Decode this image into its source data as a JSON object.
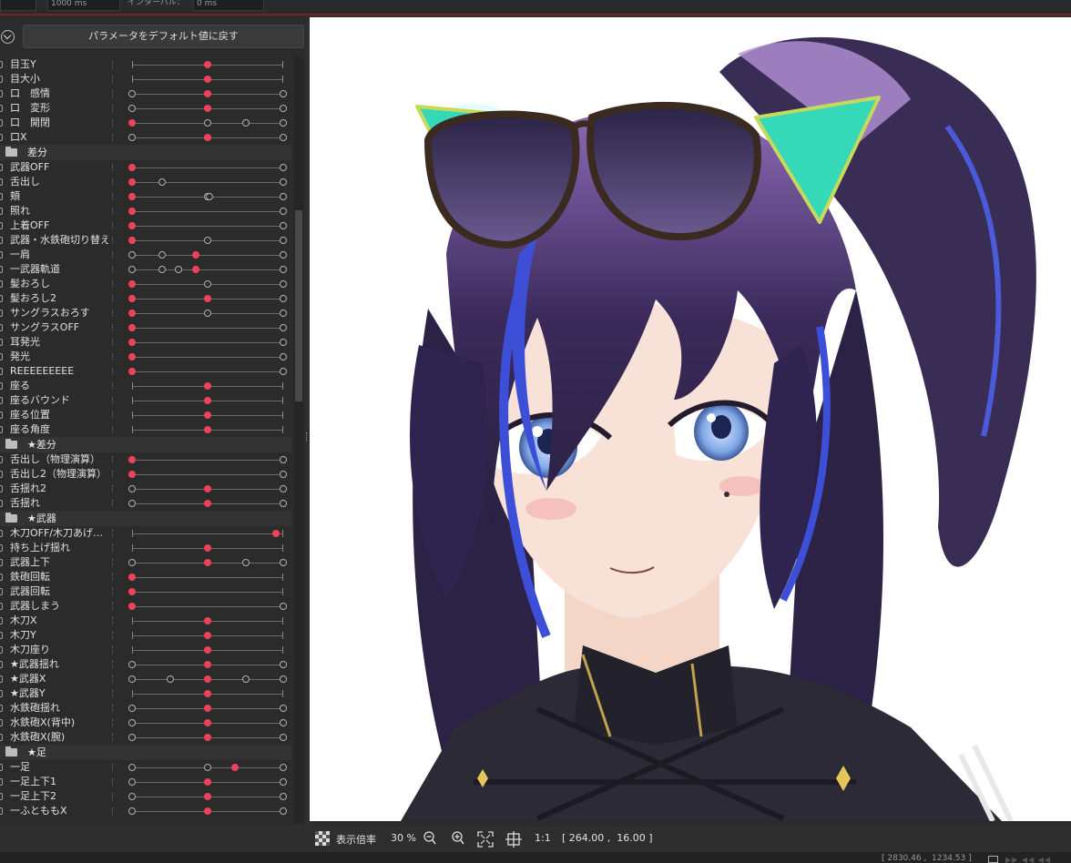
{
  "topbar": {
    "field1": "1000 ms",
    "label2": "インターバル：",
    "field2": "0 ms"
  },
  "panel": {
    "reset_button": "パラメータをデフォルト値に戻す",
    "items": [
      {
        "kind": "param",
        "label": "目玉Y",
        "dots": [
          {
            "p": 0.5,
            "s": "active"
          }
        ]
      },
      {
        "kind": "param",
        "label": "目大小",
        "dots": [
          {
            "p": 0.5,
            "s": "active"
          }
        ]
      },
      {
        "kind": "param",
        "label": "口　感情",
        "dots": [
          {
            "p": 0,
            "s": "hollow"
          },
          {
            "p": 0.5,
            "s": "active"
          },
          {
            "p": 1,
            "s": "hollow"
          }
        ]
      },
      {
        "kind": "param",
        "label": "口　変形",
        "dots": [
          {
            "p": 0,
            "s": "hollow"
          },
          {
            "p": 0.5,
            "s": "active"
          },
          {
            "p": 1,
            "s": "hollow"
          }
        ]
      },
      {
        "kind": "param",
        "label": "口　開閉",
        "dots": [
          {
            "p": 0,
            "s": "active"
          },
          {
            "p": 0.5,
            "s": "hollow"
          },
          {
            "p": 0.75,
            "s": "hollow"
          },
          {
            "p": 1,
            "s": "hollow"
          }
        ]
      },
      {
        "kind": "param",
        "label": "口X",
        "dots": [
          {
            "p": 0,
            "s": "hollow"
          },
          {
            "p": 0.5,
            "s": "active"
          },
          {
            "p": 1,
            "s": "hollow"
          }
        ]
      },
      {
        "kind": "group",
        "label": "差分"
      },
      {
        "kind": "param",
        "label": "武器OFF",
        "dots": [
          {
            "p": 0,
            "s": "active"
          },
          {
            "p": 1,
            "s": "hollow"
          }
        ]
      },
      {
        "kind": "param",
        "label": "舌出し",
        "dots": [
          {
            "p": 0,
            "s": "active"
          },
          {
            "p": 0.2,
            "s": "hollow"
          },
          {
            "p": 1,
            "s": "hollow"
          }
        ]
      },
      {
        "kind": "param",
        "label": "頬",
        "dots": [
          {
            "p": 0,
            "s": "active"
          },
          {
            "p": 0.5,
            "s": "hollow"
          },
          {
            "p": 0.51,
            "s": "hollow"
          },
          {
            "p": 1,
            "s": "hollow"
          }
        ]
      },
      {
        "kind": "param",
        "label": "照れ",
        "dots": [
          {
            "p": 0,
            "s": "active"
          },
          {
            "p": 1,
            "s": "hollow"
          }
        ]
      },
      {
        "kind": "param",
        "label": "上着OFF",
        "dots": [
          {
            "p": 0,
            "s": "active"
          },
          {
            "p": 1,
            "s": "hollow"
          }
        ]
      },
      {
        "kind": "param",
        "label": "武器・水鉄砲切り替え",
        "dots": [
          {
            "p": 0,
            "s": "active"
          },
          {
            "p": 0.5,
            "s": "hollow"
          },
          {
            "p": 1,
            "s": "hollow"
          }
        ]
      },
      {
        "kind": "param",
        "label": "一肩",
        "dots": [
          {
            "p": 0,
            "s": "hollow"
          },
          {
            "p": 0.2,
            "s": "hollow"
          },
          {
            "p": 0.42,
            "s": "active"
          },
          {
            "p": 1,
            "s": "hollow"
          }
        ]
      },
      {
        "kind": "param",
        "label": "一武器軌道",
        "dots": [
          {
            "p": 0,
            "s": "hollow"
          },
          {
            "p": 0.2,
            "s": "hollow"
          },
          {
            "p": 0.31,
            "s": "hollow"
          },
          {
            "p": 0.42,
            "s": "active"
          },
          {
            "p": 1,
            "s": "hollow"
          }
        ]
      },
      {
        "kind": "param",
        "label": "髪おろし",
        "dots": [
          {
            "p": 0,
            "s": "active"
          },
          {
            "p": 0.5,
            "s": "hollow"
          },
          {
            "p": 1,
            "s": "hollow"
          }
        ]
      },
      {
        "kind": "param",
        "label": "髪おろし2",
        "dots": [
          {
            "p": 0,
            "s": "active"
          },
          {
            "p": 0.5,
            "s": "active"
          },
          {
            "p": 1,
            "s": "hollow"
          }
        ]
      },
      {
        "kind": "param",
        "label": "サングラスおろす",
        "dots": [
          {
            "p": 0,
            "s": "active"
          },
          {
            "p": 0.5,
            "s": "hollow"
          },
          {
            "p": 1,
            "s": "hollow"
          }
        ]
      },
      {
        "kind": "param",
        "label": "サングラスOFF",
        "dots": [
          {
            "p": 0,
            "s": "active"
          },
          {
            "p": 1,
            "s": "hollow"
          }
        ]
      },
      {
        "kind": "param",
        "label": "耳発光",
        "dots": [
          {
            "p": 0,
            "s": "active"
          },
          {
            "p": 1,
            "s": "hollow"
          }
        ]
      },
      {
        "kind": "param",
        "label": "発光",
        "dots": [
          {
            "p": 0,
            "s": "active"
          },
          {
            "p": 1,
            "s": "hollow"
          }
        ]
      },
      {
        "kind": "param",
        "label": "REEEEEEEEE",
        "dots": [
          {
            "p": 0,
            "s": "active"
          },
          {
            "p": 1,
            "s": "hollow"
          }
        ]
      },
      {
        "kind": "param",
        "label": "座る",
        "dots": [
          {
            "p": 0.5,
            "s": "active"
          }
        ]
      },
      {
        "kind": "param",
        "label": "座るバウンド",
        "dots": [
          {
            "p": 0.5,
            "s": "active"
          }
        ]
      },
      {
        "kind": "param",
        "label": "座る位置",
        "dots": [
          {
            "p": 0.5,
            "s": "active"
          }
        ]
      },
      {
        "kind": "param",
        "label": "座る角度",
        "dots": [
          {
            "p": 0.5,
            "s": "active"
          }
        ]
      },
      {
        "kind": "group",
        "label": "★差分"
      },
      {
        "kind": "param",
        "label": "舌出し（物理演算）",
        "dots": [
          {
            "p": 0,
            "s": "active"
          },
          {
            "p": 1,
            "s": "hollow"
          }
        ]
      },
      {
        "kind": "param",
        "label": "舌出し2（物理演算）",
        "dots": [
          {
            "p": 0,
            "s": "active"
          },
          {
            "p": 1,
            "s": "hollow"
          }
        ]
      },
      {
        "kind": "param",
        "label": "舌揺れ2",
        "dots": [
          {
            "p": 0,
            "s": "hollow"
          },
          {
            "p": 0.5,
            "s": "active"
          },
          {
            "p": 1,
            "s": "hollow"
          }
        ]
      },
      {
        "kind": "param",
        "label": "舌揺れ",
        "dots": [
          {
            "p": 0,
            "s": "hollow"
          },
          {
            "p": 0.5,
            "s": "active"
          },
          {
            "p": 1,
            "s": "hollow"
          }
        ]
      },
      {
        "kind": "group",
        "label": "★武器"
      },
      {
        "kind": "param",
        "label": "木刀OFF/木刀あげ…",
        "dots": [
          {
            "p": 0.95,
            "s": "active"
          }
        ]
      },
      {
        "kind": "param",
        "label": "持ち上げ揺れ",
        "dots": [
          {
            "p": 0.5,
            "s": "active"
          }
        ]
      },
      {
        "kind": "param",
        "label": "武器上下",
        "dots": [
          {
            "p": 0,
            "s": "hollow"
          },
          {
            "p": 0.5,
            "s": "active"
          },
          {
            "p": 0.75,
            "s": "hollow"
          },
          {
            "p": 1,
            "s": "hollow"
          }
        ]
      },
      {
        "kind": "param",
        "label": "鉄砲回転",
        "dots": [
          {
            "p": 0,
            "s": "active"
          }
        ]
      },
      {
        "kind": "param",
        "label": "武器回転",
        "dots": [
          {
            "p": 0,
            "s": "active"
          }
        ]
      },
      {
        "kind": "param",
        "label": "武器しまう",
        "dots": [
          {
            "p": 0,
            "s": "active"
          },
          {
            "p": 1,
            "s": "hollow"
          }
        ]
      },
      {
        "kind": "param",
        "label": "木刀X",
        "dots": [
          {
            "p": 0.5,
            "s": "active"
          }
        ]
      },
      {
        "kind": "param",
        "label": "木刀Y",
        "dots": [
          {
            "p": 0.5,
            "s": "active"
          }
        ]
      },
      {
        "kind": "param",
        "label": "木刀座り",
        "dots": [
          {
            "p": 0.5,
            "s": "active"
          }
        ]
      },
      {
        "kind": "param",
        "label": "★武器揺れ",
        "dots": [
          {
            "p": 0,
            "s": "hollow"
          },
          {
            "p": 0.5,
            "s": "active"
          },
          {
            "p": 1,
            "s": "hollow"
          }
        ]
      },
      {
        "kind": "param",
        "label": "★武器X",
        "dots": [
          {
            "p": 0,
            "s": "hollow"
          },
          {
            "p": 0.25,
            "s": "hollow"
          },
          {
            "p": 0.5,
            "s": "active"
          },
          {
            "p": 0.75,
            "s": "hollow"
          },
          {
            "p": 1,
            "s": "hollow"
          }
        ]
      },
      {
        "kind": "param",
        "label": "★武器Y",
        "dots": [
          {
            "p": 0.5,
            "s": "active"
          }
        ]
      },
      {
        "kind": "param",
        "label": "水鉄砲揺れ",
        "dots": [
          {
            "p": 0,
            "s": "hollow"
          },
          {
            "p": 0.5,
            "s": "active"
          },
          {
            "p": 1,
            "s": "hollow"
          }
        ]
      },
      {
        "kind": "param",
        "label": "水鉄砲X(背中)",
        "dots": [
          {
            "p": 0,
            "s": "hollow"
          },
          {
            "p": 0.5,
            "s": "active"
          },
          {
            "p": 1,
            "s": "hollow"
          }
        ]
      },
      {
        "kind": "param",
        "label": "水鉄砲X(腕)",
        "dots": [
          {
            "p": 0,
            "s": "hollow"
          },
          {
            "p": 0.5,
            "s": "active"
          },
          {
            "p": 1,
            "s": "hollow"
          }
        ]
      },
      {
        "kind": "group",
        "label": "★足"
      },
      {
        "kind": "param",
        "label": "一足",
        "dots": [
          {
            "p": 0,
            "s": "hollow"
          },
          {
            "p": 0.5,
            "s": "hollow"
          },
          {
            "p": 0.68,
            "s": "active"
          },
          {
            "p": 1,
            "s": "hollow"
          }
        ]
      },
      {
        "kind": "param",
        "label": "一足上下1",
        "dots": [
          {
            "p": 0,
            "s": "hollow"
          },
          {
            "p": 0.5,
            "s": "active"
          },
          {
            "p": 1,
            "s": "hollow"
          }
        ]
      },
      {
        "kind": "param",
        "label": "一足上下2",
        "dots": [
          {
            "p": 0,
            "s": "hollow"
          },
          {
            "p": 0.5,
            "s": "active"
          },
          {
            "p": 1,
            "s": "hollow"
          }
        ]
      },
      {
        "kind": "param",
        "label": "一ふとももX",
        "dots": [
          {
            "p": 0,
            "s": "hollow"
          },
          {
            "p": 0.5,
            "s": "active"
          },
          {
            "p": 1,
            "s": "hollow"
          }
        ]
      }
    ]
  },
  "bottom": {
    "zoom_label": "表示倍率",
    "zoom_value": "30 %",
    "actual_size": "1:1",
    "coordinates": "[ 264.00 ,  16.00 ]"
  },
  "status": {
    "coords": "[ 2830.46 ,  1234.53 ]"
  },
  "icons": [
    "checker-icon",
    "zoom-out-icon",
    "zoom-in-icon",
    "fit-screen-icon",
    "crosshair-icon",
    "folder-icon",
    "collapse-icon"
  ],
  "colors": {
    "active_dot": "#f0415a",
    "panel_bg": "#2b2b2b",
    "topbar_accent": "#7a1f23"
  }
}
